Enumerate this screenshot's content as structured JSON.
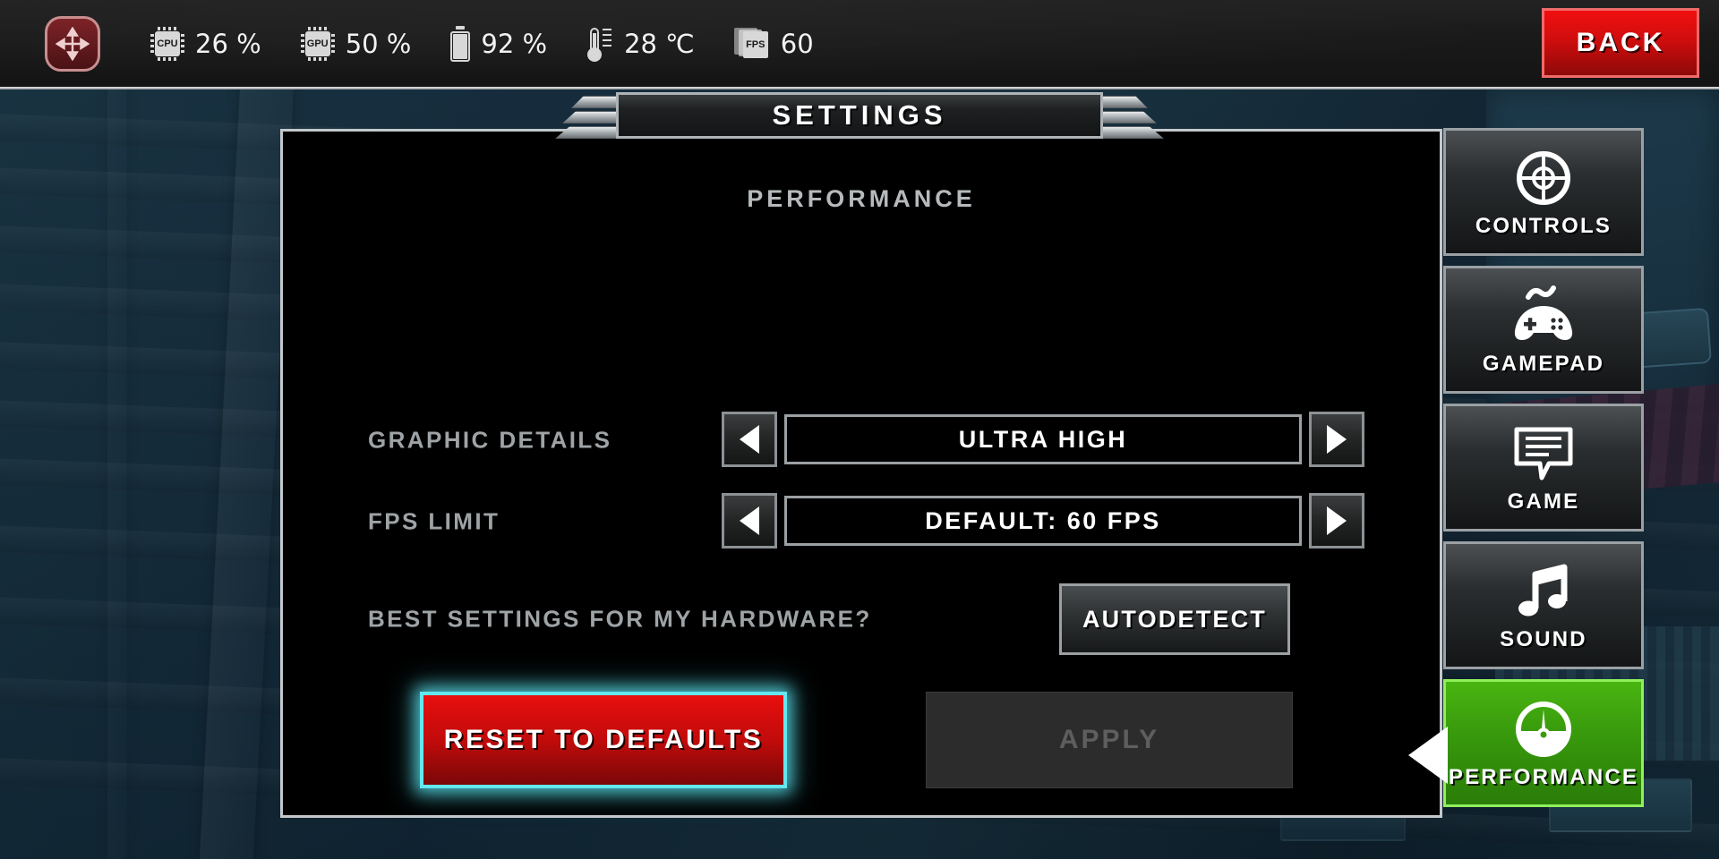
{
  "topbar": {
    "joystick_icon": "move-arrows-icon",
    "stats": [
      {
        "id": "cpu",
        "icon": "cpu-chip-icon",
        "icon_text": "CPU",
        "value": "26 %"
      },
      {
        "id": "gpu",
        "icon": "gpu-chip-icon",
        "icon_text": "GPU",
        "value": "50 %"
      },
      {
        "id": "battery",
        "icon": "battery-icon",
        "icon_text": "",
        "value": "92 %"
      },
      {
        "id": "temp",
        "icon": "thermometer-icon",
        "icon_text": "",
        "value": "28 ℃"
      },
      {
        "id": "fps",
        "icon": "fps-pages-icon",
        "icon_text": "FPS",
        "value": "60"
      }
    ],
    "back_label": "BACK"
  },
  "window": {
    "title": "SETTINGS"
  },
  "main": {
    "section_heading": "PERFORMANCE",
    "settings": [
      {
        "label": "GRAPHIC DETAILS",
        "value": "ULTRA HIGH",
        "prev_icon": "triangle-left-icon",
        "next_icon": "triangle-right-icon"
      },
      {
        "label": "FPS LIMIT",
        "value": "DEFAULT: 60 FPS",
        "prev_icon": "triangle-left-icon",
        "next_icon": "triangle-right-icon"
      }
    ],
    "autodetect": {
      "label": "BEST SETTINGS FOR MY HARDWARE?",
      "button_label": "AUTODETECT"
    },
    "actions": {
      "reset_label": "RESET TO DEFAULTS",
      "apply_label": "APPLY"
    }
  },
  "sidebar": {
    "tabs": [
      {
        "label": "CONTROLS",
        "icon": "crosshair-target-icon",
        "active": false
      },
      {
        "label": "GAMEPAD",
        "icon": "gamepad-icon",
        "active": false
      },
      {
        "label": "GAME",
        "icon": "speech-bubble-icon",
        "active": false
      },
      {
        "label": "SOUND",
        "icon": "music-note-icon",
        "active": false
      },
      {
        "label": "PERFORMANCE",
        "icon": "speedometer-icon",
        "active": true
      }
    ]
  },
  "colors": {
    "accent_green": "#49b511",
    "danger_red": "#e80e0e",
    "highlight_cyan": "#63e7ef",
    "panel_border": "#c4c8cb",
    "label_gray": "#9ea3a6",
    "background_navy": "#132b3a"
  }
}
